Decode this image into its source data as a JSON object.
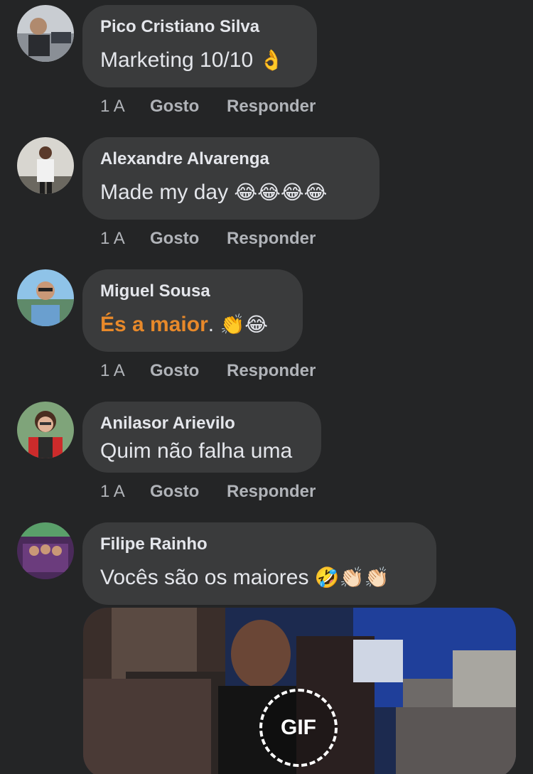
{
  "comments": [
    {
      "author": "Pico Cristiano Silva",
      "text": "Marketing 10/10",
      "emoji": "👌",
      "time": "1 A",
      "like": "Gosto",
      "reply": "Responder"
    },
    {
      "author": "Alexandre Alvarenga",
      "text": "Made my day",
      "emoji": "😂😂😂😂",
      "time": "1 A",
      "like": "Gosto",
      "reply": "Responder"
    },
    {
      "author": "Miguel Sousa",
      "text_highlight": "És a maior",
      "text": ".",
      "emoji": "👏😂",
      "time": "1 A",
      "like": "Gosto",
      "reply": "Responder"
    },
    {
      "author": "Anilasor Arievilo",
      "text": "Quim não falha uma",
      "time": "1 A",
      "like": "Gosto",
      "reply": "Responder"
    },
    {
      "author": "Filipe Rainho",
      "text": "Vocês são os maiores",
      "emoji": "🤣👏🏻👏🏻"
    }
  ],
  "gif": {
    "badge": "GIF"
  },
  "colors": {
    "background": "#242526",
    "bubble": "#3a3b3c",
    "highlight": "#e8892a",
    "meta": "#b0b3b8"
  }
}
